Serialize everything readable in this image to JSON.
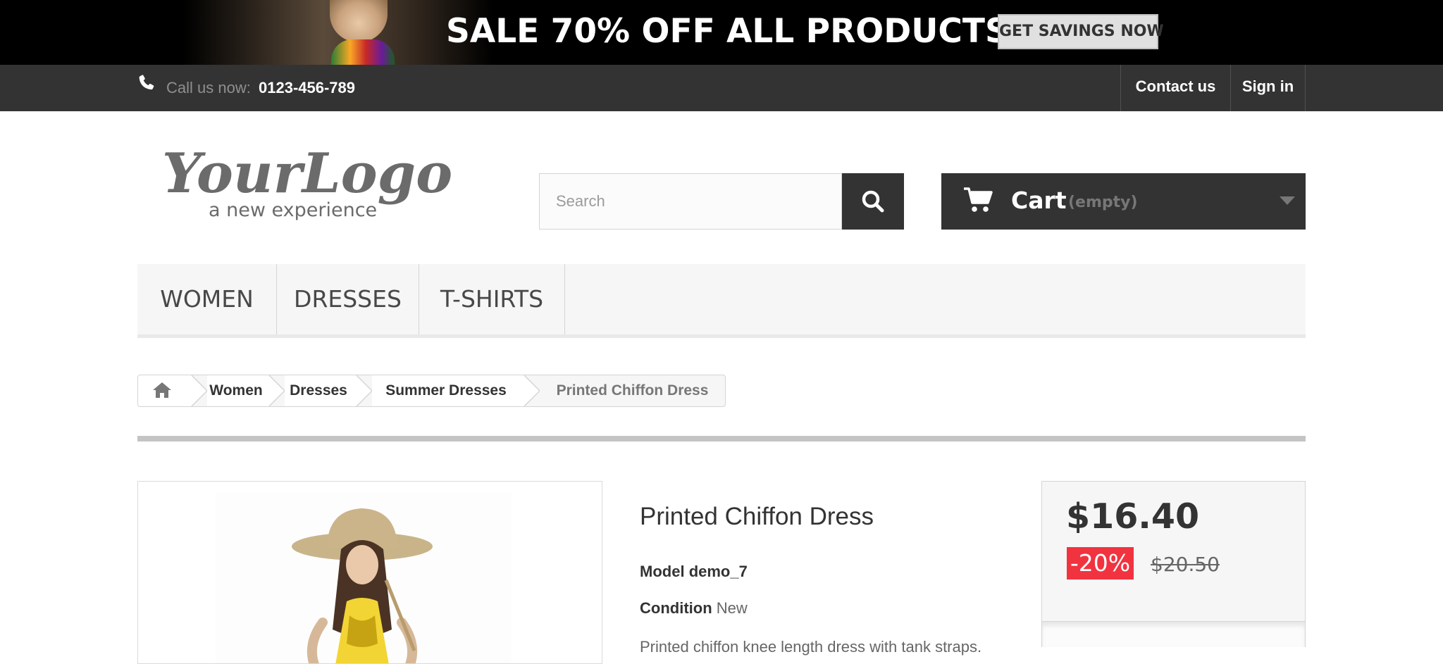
{
  "banner": {
    "text": "SALE 70% OFF ALL PRODUCTS",
    "button_label": "GET SAVINGS NOW"
  },
  "topbar": {
    "call_label": "Call us now:",
    "phone": "0123-456-789",
    "links": [
      "Contact us",
      "Sign in"
    ]
  },
  "header": {
    "logo_text": "YourLogo",
    "logo_tagline": "a new experience",
    "search_placeholder": "Search",
    "cart_label": "Cart",
    "cart_status": "(empty)"
  },
  "menu": {
    "items": [
      "WOMEN",
      "DRESSES",
      "T-SHIRTS"
    ]
  },
  "breadcrumb": {
    "items": [
      "Women",
      "Dresses",
      "Summer Dresses"
    ],
    "current": "Printed Chiffon Dress"
  },
  "product": {
    "title": "Printed Chiffon Dress",
    "model_label": "Model",
    "model_value": "demo_7",
    "condition_label": "Condition",
    "condition_value": "New",
    "description_partial": "Printed chiffon knee length dress with tank straps."
  },
  "price": {
    "current": "$16.40",
    "discount": "-20%",
    "old": "$20.50"
  },
  "colors": {
    "dark": "#333333",
    "discount_red": "#f13340",
    "menu_bg": "#f6f6f6"
  }
}
